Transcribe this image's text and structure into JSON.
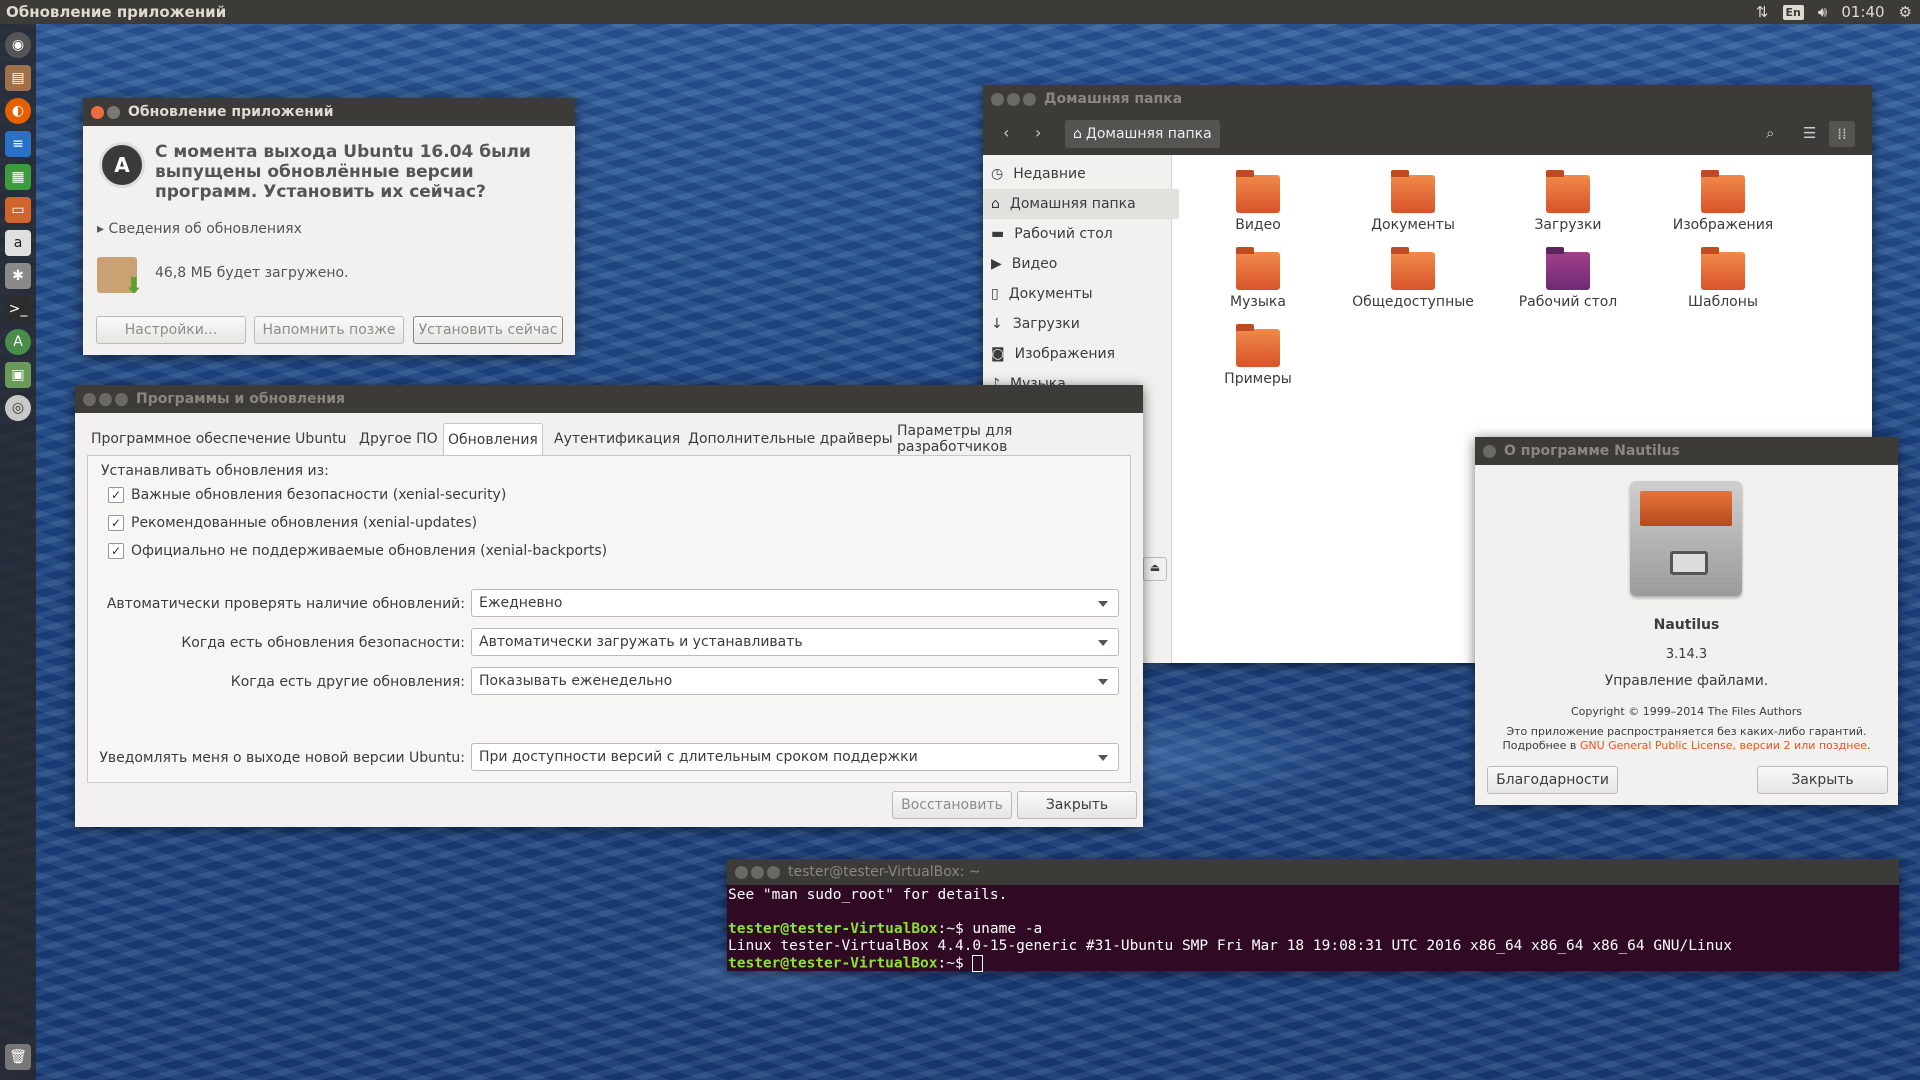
{
  "topbar": {
    "app_title": "Обновление приложений",
    "keyboard": "En",
    "time": "01:40"
  },
  "launcher": {
    "icons": [
      "dash-icon",
      "files-icon",
      "firefox-icon",
      "writer-icon",
      "calc-icon",
      "impress-icon",
      "amazon-icon",
      "settings-icon",
      "terminal-icon",
      "updater-icon",
      "image-icon",
      "dvd-icon",
      "trash-icon"
    ]
  },
  "updater": {
    "title": "Обновление приложений",
    "heading": "С момента выхода Ubuntu 16.04 были выпущены обновлённые версии программ. Установить их сейчас?",
    "details": "Сведения об обновлениях",
    "download_size": "46,8 МБ будет загружено.",
    "btn_settings": "Настройки...",
    "btn_remind": "Напомнить позже",
    "btn_install": "Установить сейчас"
  },
  "swprops": {
    "title": "Программы и обновления",
    "tabs": [
      "Программное обеспечение Ubuntu",
      "Другое ПО",
      "Обновления",
      "Аутентификация",
      "Дополнительные драйверы",
      "Параметры для разработчиков"
    ],
    "install_from": "Устанавливать обновления из:",
    "checks": [
      "Важные обновления безопасности (xenial-security)",
      "Рекомендованные обновления (xenial-updates)",
      "Официально не поддерживаемые обновления (xenial-backports)"
    ],
    "rows": [
      {
        "label": "Автоматически проверять наличие обновлений:",
        "value": "Ежедневно"
      },
      {
        "label": "Когда есть обновления безопасности:",
        "value": "Автоматически загружать и устанавливать"
      },
      {
        "label": "Когда есть другие обновления:",
        "value": "Показывать еженедельно"
      },
      {
        "label": "Уведомлять меня о выходе новой версии Ubuntu:",
        "value": "При доступности версий с длительным сроком поддержки"
      }
    ],
    "btn_revert": "Восстановить",
    "btn_close": "Закрыть"
  },
  "files": {
    "title": "Домашняя папка",
    "path": "Домашняя папка",
    "sidebar": [
      "Недавние",
      "Домашняя папка",
      "Рабочий стол",
      "Видео",
      "Документы",
      "Загрузки",
      "Изображения",
      "Музыка"
    ],
    "folders": [
      "Видео",
      "Документы",
      "Загрузки",
      "Изображения",
      "Музыка",
      "Общедоступные",
      "Рабочий стол",
      "Шаблоны",
      "Примеры"
    ]
  },
  "about": {
    "title": "О программе Nautilus",
    "name": "Nautilus",
    "version": "3.14.3",
    "description": "Управление файлами.",
    "copyright": "Copyright © 1999–2014 The Files Authors",
    "license1": "Это приложение распространяется без каких-либо гарантий.",
    "license2_prefix": "Подробнее в ",
    "license_link": "GNU General Public License, версии 2 или позднее",
    "license2_suffix": ".",
    "btn_credits": "Благодарности",
    "btn_close": "Закрыть"
  },
  "terminal": {
    "title": "tester@tester-VirtualBox: ~",
    "line1": "See \"man sudo_root\" for details.",
    "prompt": "tester@tester-VirtualBox",
    "cmd": ":~$ uname -a",
    "output": "Linux tester-VirtualBox 4.4.0-15-generic #31-Ubuntu SMP Fri Mar 18 19:08:31 UTC 2016 x86_64 x86_64 x86_64 GNU/Linux",
    "prompt_end": ":~$ "
  },
  "colors": {
    "accent": "#e95420",
    "panel": "#3c3b37",
    "terminal_bg": "#300a24",
    "prompt": "#8ae234"
  }
}
